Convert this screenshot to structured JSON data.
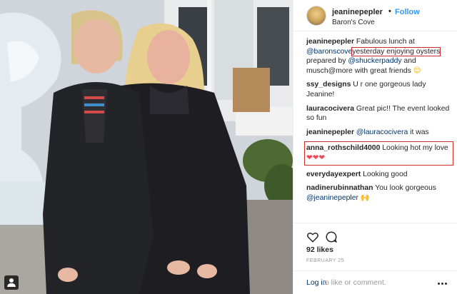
{
  "post": {
    "username": "jeaninepepler",
    "separator": "•",
    "follow_label": "Follow",
    "location": "Baron's Cove"
  },
  "comments": [
    {
      "user": "jeaninepepler",
      "parts": [
        "Fabulous lunch at ",
        "@baronscove",
        " ",
        "yesterday enjoying oysters",
        " prepared by ",
        "@shuckerpaddy",
        " and musch@more with great friends "
      ]
    },
    {
      "user": "ssy_designs",
      "text": "U r one gorgeous lady Jeanine!"
    },
    {
      "user": "lauracocivera",
      "text": "Great pic!! The event looked so fun"
    },
    {
      "user": "jeaninepepler",
      "mention": "@lauracocivera",
      "text": " it was"
    },
    {
      "user": "anna_rothschild4000",
      "text": "Looking hot my love ",
      "hearts": "❤❤❤"
    },
    {
      "user": "everydayexpert",
      "text": "Looking good"
    },
    {
      "user": "nadinerubinnathan",
      "text": "You look gorgeous ",
      "mention": "@jeaninepepler",
      "emoji": "🙌"
    }
  ],
  "emoji_smile": "😊",
  "likes_label": "92 likes",
  "date_label": "FEBRUARY 25",
  "login": {
    "link": "Log in",
    "rest": "to like or comment."
  },
  "icons": {
    "like": "heart-icon",
    "comment": "comment-icon",
    "more": "more-icon",
    "tag": "user-tag-icon"
  }
}
